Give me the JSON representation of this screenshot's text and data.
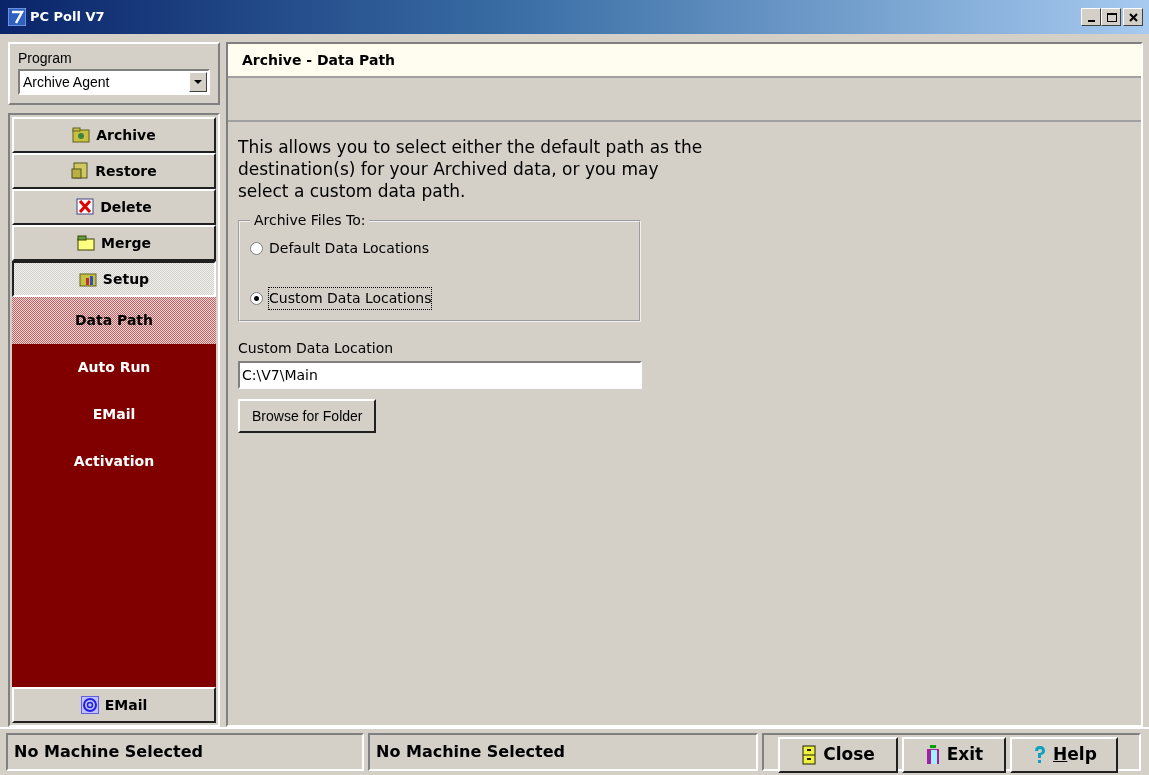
{
  "window": {
    "title": "PC Poll V7"
  },
  "program": {
    "label": "Program",
    "value": "Archive Agent"
  },
  "nav": [
    {
      "label": "Archive",
      "kind": "archive",
      "selected": false
    },
    {
      "label": "Restore",
      "kind": "restore",
      "selected": false
    },
    {
      "label": "Delete",
      "kind": "delete",
      "selected": false
    },
    {
      "label": "Merge",
      "kind": "merge",
      "selected": false
    },
    {
      "label": "Setup",
      "kind": "setup",
      "selected": true,
      "children": [
        {
          "label": "Data Path",
          "selected": true
        },
        {
          "label": "Auto Run",
          "selected": false
        },
        {
          "label": "EMail",
          "selected": false
        },
        {
          "label": "Activation",
          "selected": false
        }
      ]
    }
  ],
  "nav_bottom": [
    {
      "label": "EMail",
      "kind": "email",
      "selected": false
    }
  ],
  "panel": {
    "title": "Archive - Data Path",
    "description": "This allows you to select either the default path as the destination(s) for your Archived data, or you may select a custom data path.",
    "group": {
      "legend": "Archive Files To:",
      "options": [
        {
          "label": "Default Data Locations",
          "selected": false
        },
        {
          "label": "Custom Data Locations",
          "selected": true
        }
      ]
    },
    "field": {
      "label": "Custom Data Location",
      "value": "C:\\V7\\Main"
    },
    "browse_button": "Browse for Folder"
  },
  "status_bar": [
    "No Machine Selected",
    "No Machine Selected"
  ],
  "buttons": [
    {
      "label": "Close",
      "kind": "close",
      "underline_first": false
    },
    {
      "label": "Exit",
      "kind": "exit",
      "underline_first": false
    },
    {
      "label": "Help",
      "kind": "help",
      "underline_first": true
    }
  ]
}
